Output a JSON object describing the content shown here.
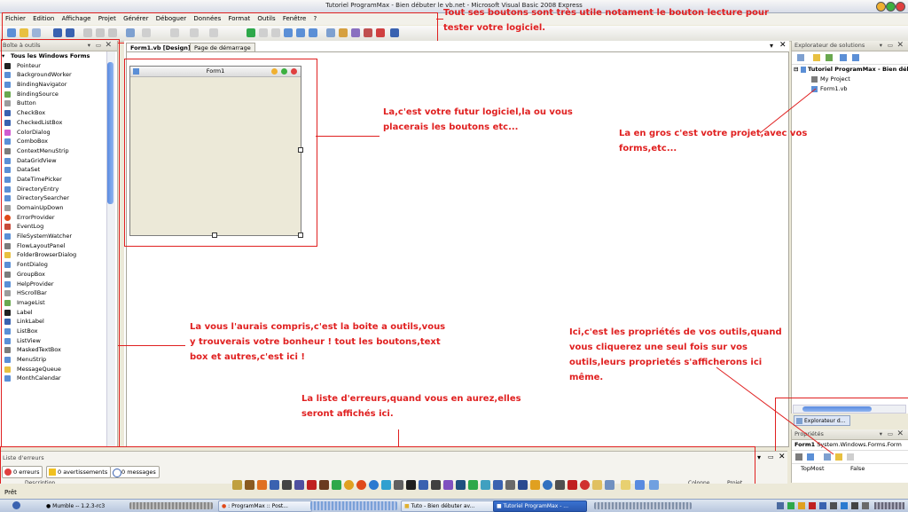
{
  "window": {
    "title": "Tutoriel ProgramMax - Bien débuter le vb.net - Microsoft Visual Basic 2008 Express"
  },
  "menu": [
    "Fichier",
    "Edition",
    "Affichage",
    "Projet",
    "Générer",
    "Déboguer",
    "Données",
    "Format",
    "Outils",
    "Fenêtre",
    "?"
  ],
  "toolbox": {
    "title": "Boîte à outils",
    "group": "Tous les Windows Forms",
    "items": [
      "Pointeur",
      "BackgroundWorker",
      "BindingNavigator",
      "BindingSource",
      "Button",
      "CheckBox",
      "CheckedListBox",
      "ColorDialog",
      "ComboBox",
      "ContextMenuStrip",
      "DataGridView",
      "DataSet",
      "DateTimePicker",
      "DirectoryEntry",
      "DirectorySearcher",
      "DomainUpDown",
      "ErrorProvider",
      "EventLog",
      "FileSystemWatcher",
      "FlowLayoutPanel",
      "FolderBrowserDialog",
      "FontDialog",
      "GroupBox",
      "HelpProvider",
      "HScrollBar",
      "ImageList",
      "Label",
      "LinkLabel",
      "ListBox",
      "ListView",
      "MaskedTextBox",
      "MenuStrip",
      "MessageQueue",
      "MonthCalendar"
    ]
  },
  "editor": {
    "tabs": [
      "Form1.vb [Design]",
      "Page de démarrage"
    ],
    "form_title": "Form1"
  },
  "solution": {
    "title": "Explorateur de solutions",
    "project": "Tutoriel ProgramMax - Bien déb",
    "items": [
      "My Project",
      "Form1.vb"
    ],
    "tab_label": "Explorateur d..."
  },
  "properties": {
    "title": "Propriétés",
    "object": "Form1",
    "object_type": "System.Windows.Forms.Form",
    "row_name": "TopMost",
    "row_value": "False"
  },
  "errors": {
    "title": "Liste d'erreurs",
    "errors_label": "0 erreurs",
    "warnings_label": "0 avertissements",
    "messages_label": "0 messages",
    "col_description": "Description",
    "col_colonne": "Colonne",
    "col_projet": "Projet"
  },
  "statusbar": {
    "text": "Prêt"
  },
  "taskbar": [
    "Mumble -- 1.2.3-rc3",
    ": ProgramMax :: Post...",
    "Tuto - Bien débuter av...",
    "Tutoriel ProgramMax - ..."
  ],
  "annotations": {
    "toolbar": "Tout ses boutons sont très utile notament le bouton lecture pour tester votre logiciel.",
    "form": "La,c'est votre futur logiciel,la ou vous placerais les boutons etc...",
    "solution": "La en gros c'est votre projet,avec vos forms,etc...",
    "toolbox": "La vous l'aurais compris,c'est la boite a outils,vous y trouverais votre bonheur ! tout les boutons,text box et autres,c'est ici !",
    "properties": "Ici,c'est les propriétés de vos outils,quand vous cliquerez une seul fois sur vos outils,leurs proprietés s'afficherons ici même.",
    "errors": "La liste d'erreurs,quand vous en aurez,elles seront affichés ici."
  },
  "colors": {
    "annotation": "#e02020",
    "accent": "#316ac5"
  }
}
